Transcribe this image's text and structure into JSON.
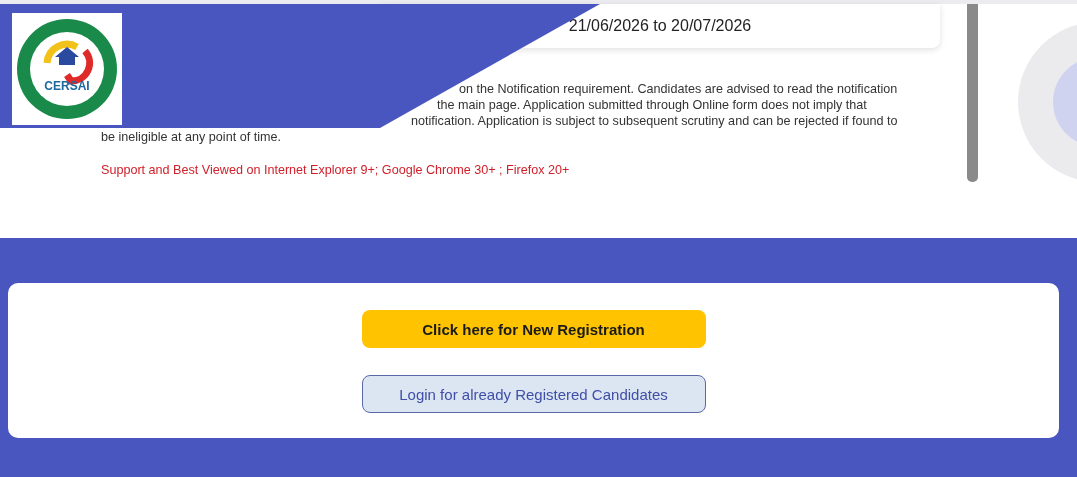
{
  "logo": {
    "text": "CERSAI"
  },
  "period": {
    "text": "21/06/2026 to 20/07/2026"
  },
  "notice": {
    "lines": [
      "on the Notification requirement. Candidates are advised to read the notification",
      "the main page. Application submitted through Online form does not imply that",
      "notification. Application is subject to subsequent scrutiny and can be rejected if found to",
      "be ineligible at any point of time."
    ]
  },
  "browser_support": "Support and Best Viewed on Internet Explorer 9+; Google Chrome 30+ ; Firefox 20+",
  "buttons": [
    {
      "label": "Click here for New Registration",
      "kind": "primary"
    },
    {
      "label": "Login for already Registered Candidates",
      "kind": "secondary"
    }
  ]
}
